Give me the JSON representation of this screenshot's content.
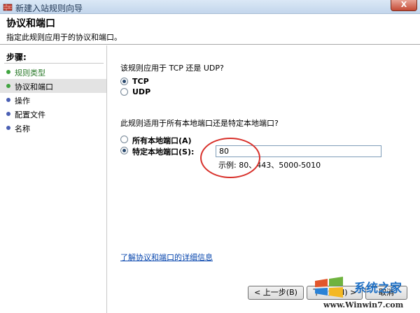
{
  "window": {
    "title": "新建入站规则向导",
    "close_label": "X"
  },
  "header": {
    "title": "协议和端口",
    "subtitle": "指定此规则应用于的协议和端口。"
  },
  "sidebar": {
    "steps_label": "步骤:",
    "items": [
      {
        "label": "规则类型",
        "state": "done"
      },
      {
        "label": "协议和端口",
        "state": "current"
      },
      {
        "label": "操作",
        "state": "pending"
      },
      {
        "label": "配置文件",
        "state": "pending"
      },
      {
        "label": "名称",
        "state": "pending"
      }
    ]
  },
  "main": {
    "protocol_question": "该规则应用于 TCP 还是 UDP?",
    "protocol_options": [
      {
        "label": "TCP",
        "checked": true
      },
      {
        "label": "UDP",
        "checked": false
      }
    ],
    "port_question": "此规则适用于所有本地端口还是特定本地端口?",
    "port_options": [
      {
        "label": "所有本地端口(A)",
        "checked": false
      },
      {
        "label": "特定本地端口(S):",
        "checked": true
      }
    ],
    "port_value": "80",
    "port_example": "示例: 80、443、5000-5010",
    "help_link": "了解协议和端口的详细信息"
  },
  "buttons": {
    "back": "< 上一步(B)",
    "next": "下一步(N) >",
    "cancel": "取消"
  },
  "watermark": {
    "name": "系统之家",
    "url": "www.Winwin7.com"
  },
  "colors": {
    "accent_red": "#d8302a",
    "link_blue": "#0645ad",
    "dot_done": "#3fa43f",
    "dot_pending": "#4a5fb3"
  }
}
